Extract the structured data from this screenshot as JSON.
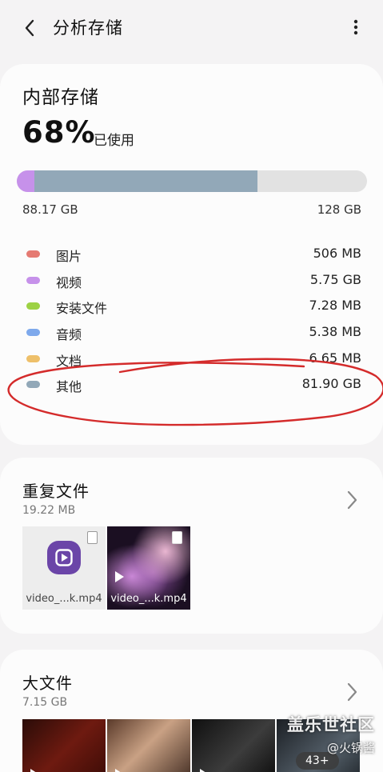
{
  "header": {
    "title": "分析存储"
  },
  "storage": {
    "title": "内部存储",
    "percent": "68%",
    "used_label": "已使用",
    "used": "88.17 GB",
    "total": "128 GB",
    "used_fraction": 0.68,
    "categories": [
      {
        "name": "图片",
        "size": "506 MB",
        "color": "#e57a72"
      },
      {
        "name": "视频",
        "size": "5.75 GB",
        "color": "#c691ea"
      },
      {
        "name": "安装文件",
        "size": "7.28 MB",
        "color": "#9dd244"
      },
      {
        "name": "音频",
        "size": "5.38 MB",
        "color": "#7ea9ec"
      },
      {
        "name": "文档",
        "size": "6.65 MB",
        "color": "#eec06a"
      },
      {
        "name": "其他",
        "size": "81.90 GB",
        "color": "#92a8b8"
      }
    ]
  },
  "duplicates": {
    "title": "重复文件",
    "size": "19.22 MB",
    "files": [
      {
        "caption": "video_...k.mp4"
      },
      {
        "caption": "video_...k.mp4"
      }
    ]
  },
  "large_files": {
    "title": "大文件",
    "size": "7.15 GB",
    "more_count": "43+"
  },
  "watermark": {
    "line1": "盖乐世社区",
    "line2": "@火锅酱"
  },
  "colors": {
    "accent_annotation": "#d42b2b",
    "video_app": "#6b45a8"
  }
}
